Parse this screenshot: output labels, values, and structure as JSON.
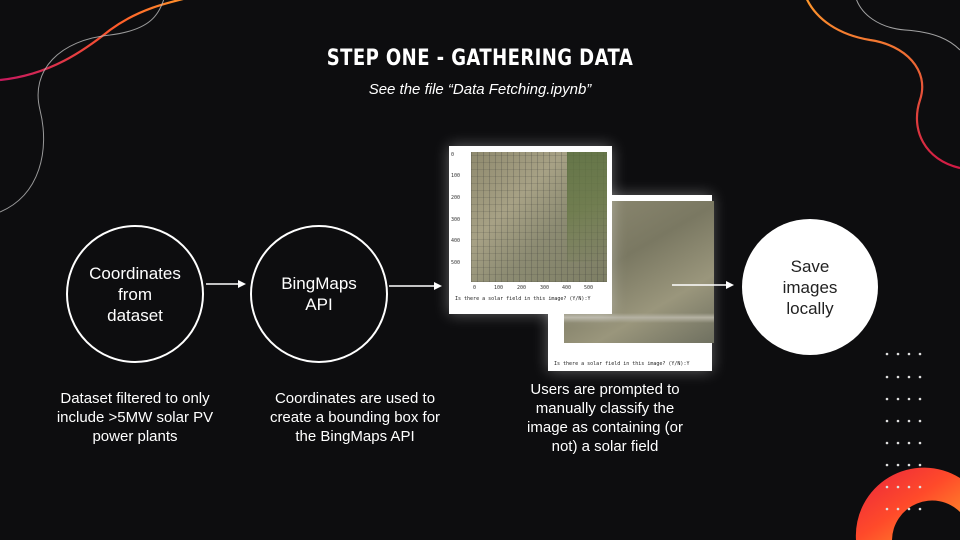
{
  "slide": {
    "title": "STEP ONE - GATHERING DATA",
    "subtitle": "See the file “Data Fetching.ipynb”"
  },
  "steps": [
    {
      "label": "Coordinates\nfrom\ndataset",
      "description": "Dataset filtered to only\ninclude >5MW solar PV\npower plants"
    },
    {
      "label": "BingMaps\nAPI",
      "description": "Coordinates are used to\ncreate a bounding box for\nthe BingMaps API"
    },
    {
      "label": "",
      "description": "Users are prompted to\nmanually classify the\nimage as containing (or\nnot) a solar field"
    },
    {
      "label": "Save\nimages\nlocally",
      "description": ""
    }
  ],
  "notebook_plot": {
    "y_ticks": [
      "0",
      "100",
      "200",
      "300",
      "400",
      "500"
    ],
    "x_ticks": [
      "0",
      "100",
      "200",
      "300",
      "400",
      "500"
    ],
    "prompt": "Is there a solar field in this image? (Y/N):Y"
  },
  "notebook_plot_2": {
    "prompt": "Is there a solar field in this image? (Y/N):Y"
  },
  "colors": {
    "background": "#0d0d0f",
    "accent_orange": "#ff7a1a",
    "accent_red": "#e8233e",
    "accent_pink": "#c81a5e"
  }
}
